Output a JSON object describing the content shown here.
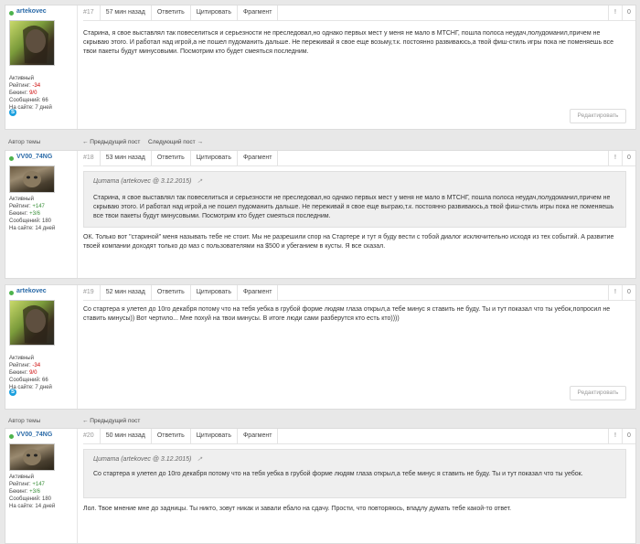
{
  "posts": [
    {
      "user": {
        "name": "artekovec",
        "status": "Активный",
        "rating_label": "Рейтинг:",
        "rating": "-34",
        "bekint_label": "Бекинг:",
        "bekint": "9/0",
        "messages": "Сообщений: 66",
        "site": "На сайте: 7 дней"
      },
      "num": "#17",
      "time": "57 мин назад",
      "reply": "Ответить",
      "quote": "Цитировать",
      "fragment": "Фрагмент",
      "flag": "!",
      "count": "0",
      "text": "Старина, я свое выставлял так повеселиться и серьезности не преследовал,но однако первых мест у меня не мало в МТСНГ, пошла полоса неудач,полудоманил,причем не скрываю этого. И работал над игрой,а не пошел пудоманить дальше. Не переживай я свое еще возьму,т.к. постоянно развиваюсь,а твой фиш-стиль игры пока не поменяешь все твои пакеты будут минусовыми. Посмотрим кто будет смеяться последним.",
      "edit": "Редактировать"
    },
    {
      "user": {
        "name": "VV00_74NG",
        "status": "Активный",
        "rating_label": "Рейтинг:",
        "rating": "+147",
        "bekint_label": "Бекинг:",
        "bekint": "+3/6",
        "messages": "Сообщений: 180",
        "site": "На сайте: 14 дней"
      },
      "num": "#18",
      "time": "53 мин назад",
      "reply": "Ответить",
      "quote": "Цитировать",
      "fragment": "Фрагмент",
      "flag": "!",
      "count": "0",
      "quote_head": "Цитата (artekovec @ 3.12.2015)",
      "quote_text": "Старина, я свое выставлял так повеселиться и серьезности не преследовал,но однако первых мест у меня не мало в МТСНГ, пошла полоса неудач,полудоманил,причем не скрываю этого. И работал над игрой,а не пошел пудоманить дальше. Не переживай я свое еще выграю,т.к. постоянно развиваюсь,а твой фиш-стиль игры пока не поменяешь все твои пакеты будут минусовыми. Посмотрим кто будет смеяться последним.",
      "text": "ОК. Только вот \"стариной\" меня называть тебе не стоит. Мы не разрешили спор на Стартере и тут я буду вести с тобой диалог исключительно исходя из тех событий. А развитие твоей компании доходят только до маз с пользователями на $500 и убеганием в кусты. Я все сказал."
    },
    {
      "user": {
        "name": "artekovec",
        "status": "Активный",
        "rating_label": "Рейтинг:",
        "rating": "-34",
        "bekint_label": "Бекинг:",
        "bekint": "9/0",
        "messages": "Сообщений: 66",
        "site": "На сайте: 7 дней"
      },
      "num": "#19",
      "time": "52 мин назад",
      "reply": "Ответить",
      "quote": "Цитировать",
      "fragment": "Фрагмент",
      "flag": "!",
      "count": "0",
      "text": "Со стартера я улетел до 10го декабря потому что на тебя уебка в грубой форме людям глаза открыл,а тебе минус я ставить не буду. Ты и тут показал что ты уебок,попросил не ставить минусы)) Вот чертило... Мне похуй на твои минусы. В итоге люди сами разберутся кто есть кто))))",
      "edit": "Редактировать"
    },
    {
      "user": {
        "name": "VV00_74NG",
        "status": "Активный",
        "rating_label": "Рейтинг:",
        "rating": "+147",
        "bekint_label": "Бекинг:",
        "bekint": "+3/6",
        "messages": "Сообщений: 180",
        "site": "На сайте: 14 дней"
      },
      "num": "#20",
      "time": "50 мин назад",
      "reply": "Ответить",
      "quote": "Цитировать",
      "fragment": "Фрагмент",
      "flag": "!",
      "count": "0",
      "quote_head": "Цитата (artekovec @ 3.12.2015)",
      "quote_text": "Со стартера я улетел до 10го декабря потому что на тебя уебка в грубой форме людям глаза открыл,а тебе минус я ставить не буду. Ты и тут показал что ты уебок.",
      "text": "Лол. Твое мнение мне до задницы. Ты никто, зовут никак и завали ебало на сдачу. Прости, что повторяюсь, впадлу думать тебе какой-то ответ."
    }
  ],
  "nav": [
    {
      "label": "Автор темы",
      "prev": "← Предыдущий пост",
      "next": "Следующий пост →"
    },
    {
      "label": "Автор темы",
      "prev": "← Предыдущий пост"
    }
  ],
  "colors": {
    "username": "#2a6aa8",
    "online": "#4db34d",
    "negative": "#cc0000",
    "positive": "#3a8f3a",
    "quote_bg": "#efefef"
  }
}
